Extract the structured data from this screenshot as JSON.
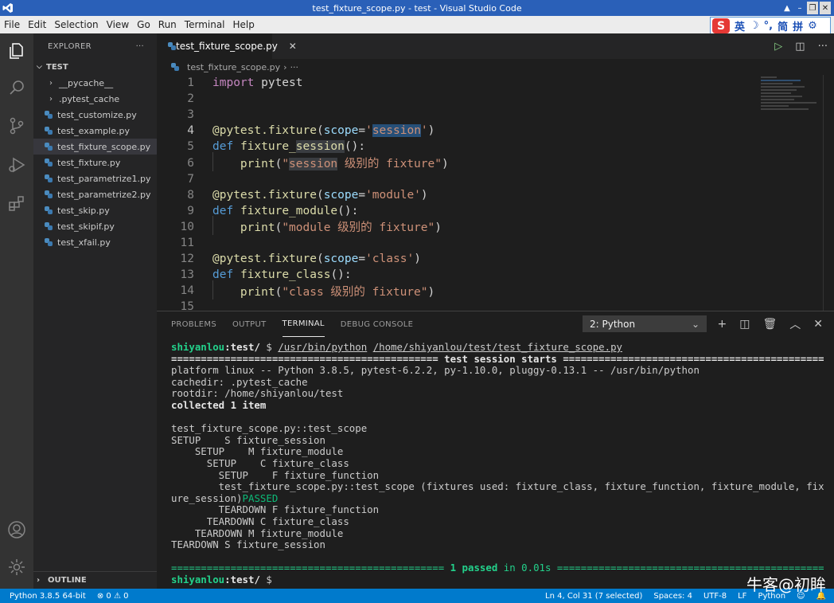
{
  "window": {
    "title": "test_fixture_scope.py - test - Visual Studio Code",
    "controls": [
      "▲",
      "–",
      "❐",
      "✕"
    ]
  },
  "menu": [
    "File",
    "Edit",
    "Selection",
    "View",
    "Go",
    "Run",
    "Terminal",
    "Help"
  ],
  "ime": {
    "logo": "S",
    "items": [
      "英",
      "☽",
      "°,",
      "简",
      "拼",
      "⚙"
    ]
  },
  "sidebar": {
    "header": "EXPLORER",
    "more": "···",
    "section": "TEST",
    "items": [
      {
        "label": "__pycache__",
        "kind": "folder"
      },
      {
        "label": ".pytest_cache",
        "kind": "folder"
      },
      {
        "label": "test_customize.py",
        "kind": "py"
      },
      {
        "label": "test_example.py",
        "kind": "py"
      },
      {
        "label": "test_fixture_scope.py",
        "kind": "py",
        "selected": true
      },
      {
        "label": "test_fixture.py",
        "kind": "py"
      },
      {
        "label": "test_parametrize1.py",
        "kind": "py"
      },
      {
        "label": "test_parametrize2.py",
        "kind": "py"
      },
      {
        "label": "test_skip.py",
        "kind": "py"
      },
      {
        "label": "test_skipif.py",
        "kind": "py"
      },
      {
        "label": "test_xfail.py",
        "kind": "py"
      }
    ],
    "outline": "OUTLINE"
  },
  "editor": {
    "tab": "test_fixture_scope.py",
    "tab_close": "✕",
    "breadcrumb_file": "test_fixture_scope.py",
    "breadcrumb_more": "···",
    "line_numbers": [
      "1",
      "2",
      "3",
      "4",
      "5",
      "6",
      "7",
      "8",
      "9",
      "10",
      "11",
      "12",
      "13",
      "14",
      "15"
    ]
  },
  "panel": {
    "tabs": [
      "PROBLEMS",
      "OUTPUT",
      "TERMINAL",
      "DEBUG CONSOLE"
    ],
    "active_tab": "TERMINAL",
    "select": "2: Python",
    "terminal": {
      "prompt_user": "shiyanlou",
      "prompt_path": "test/",
      "cmd_python": "/usr/bin/python",
      "cmd_file": "/home/shiyanlou/test/test_fixture_scope.py",
      "session_banner": "============================================= test session starts =============================================",
      "platform": "platform linux -- Python 3.8.5, pytest-6.2.2, py-1.10.0, pluggy-0.13.1 -- /usr/bin/python",
      "cachedir": "cachedir: .pytest_cache",
      "rootdir": "rootdir: /home/shiyanlou/test",
      "collected": "collected 1 item",
      "lines": [
        "test_fixture_scope.py::test_scope",
        "SETUP    S fixture_session",
        "    SETUP    M fixture_module",
        "      SETUP    C fixture_class",
        "        SETUP    F fixture_function",
        "        test_fixture_scope.py::test_scope (fixtures used: fixture_class, fixture_function, fixture_module, fixt"
      ],
      "wrap": "ure_session)",
      "passed_tag": "PASSED",
      "teardown": [
        "        TEARDOWN F fixture_function",
        "      TEARDOWN C fixture_class",
        "    TEARDOWN M fixture_module",
        "TEARDOWN S fixture_session"
      ],
      "result_left": "============================================== ",
      "result_passed": "1 passed",
      "result_time": " in 0.01s ",
      "result_right": "============================================="
    }
  },
  "status": {
    "python": "Python 3.8.5 64-bit",
    "errors": "0",
    "warnings": "0",
    "position": "Ln 4, Col 31 (7 selected)",
    "spaces": "Spaces: 4",
    "encoding": "UTF-8",
    "eol": "LF",
    "language": "Python"
  },
  "watermark": "牛客@初眸"
}
